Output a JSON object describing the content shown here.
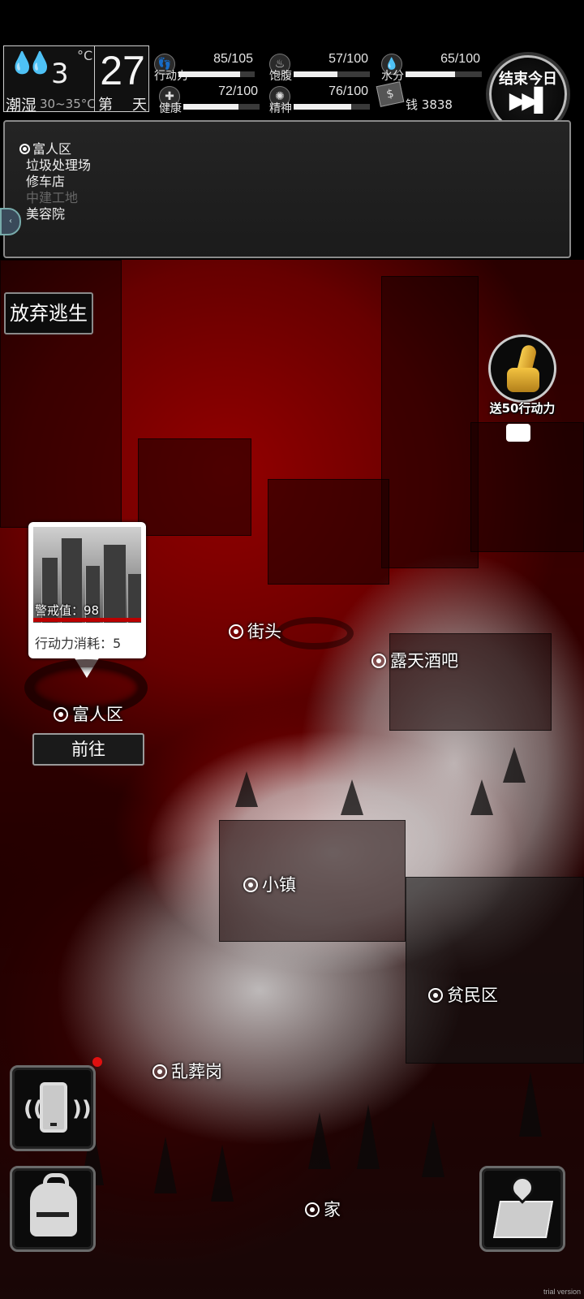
{
  "weather": {
    "icon": "water-drops-icon",
    "temperature": "3",
    "unit": "°C",
    "condition": "潮湿",
    "range": "30~35°C"
  },
  "day": {
    "prefix": "第",
    "number": "27",
    "suffix": "天"
  },
  "stats": [
    {
      "label": "行动力",
      "value": "85/105",
      "fraction": 0.81,
      "icon": "footprint-icon"
    },
    {
      "label": "饱腹",
      "value": "57/100",
      "fraction": 0.57,
      "icon": "stomach-icon"
    },
    {
      "label": "水分",
      "value": "65/100",
      "fraction": 0.65,
      "icon": "water-icon"
    },
    {
      "label": "健康",
      "value": "72/100",
      "fraction": 0.72,
      "icon": "health-cross-icon"
    },
    {
      "label": "精神",
      "value": "76/100",
      "fraction": 0.76,
      "icon": "spirit-flame-icon"
    }
  ],
  "money": {
    "label": "钱",
    "value": "3838",
    "icon": "cash-stack-icon"
  },
  "end_day": {
    "label": "结束今日",
    "icon": "fast-forward-icon"
  },
  "location_list": [
    {
      "name": "富人区",
      "selected": true,
      "disabled": false
    },
    {
      "name": "垃圾处理场",
      "selected": false,
      "disabled": false
    },
    {
      "name": "修车店",
      "selected": false,
      "disabled": false
    },
    {
      "name": "中建工地",
      "selected": false,
      "disabled": true
    },
    {
      "name": "美容院",
      "selected": false,
      "disabled": false
    }
  ],
  "give_up_label": "放弃逃生",
  "ad_reward": {
    "label": "送50行动力",
    "icons": [
      "thumbs-up-icon",
      "video-camera-icon"
    ]
  },
  "popup": {
    "alert": "警戒值：98",
    "cost": "行动力消耗：5"
  },
  "go_label": "前往",
  "map_pins": [
    {
      "name": "富人区"
    },
    {
      "name": "街头"
    },
    {
      "name": "露天酒吧"
    },
    {
      "name": "小镇"
    },
    {
      "name": "贫民区"
    },
    {
      "name": "乱葬岗"
    },
    {
      "name": "家"
    }
  ],
  "bottom_buttons": {
    "phone": "phone-icon",
    "backpack": "backpack-icon",
    "map": "map-icon"
  },
  "watermark": "trial version",
  "colors": {
    "accent_red": "#b00000",
    "notification": "#e01010"
  }
}
